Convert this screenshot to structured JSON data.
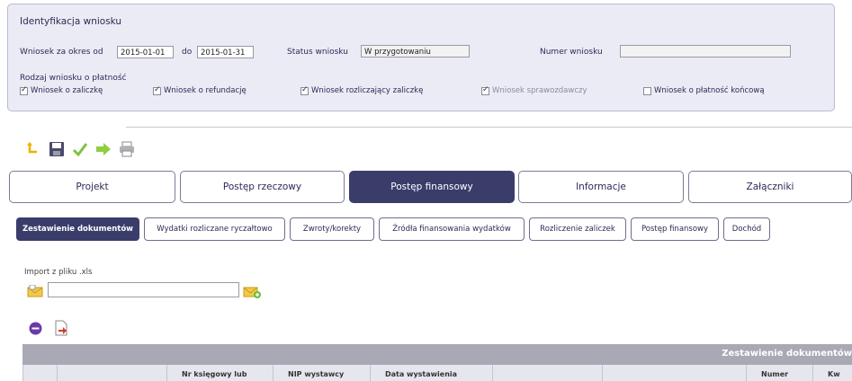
{
  "panel": {
    "title": "Identyfikacja wniosku",
    "period_from_label": "Wniosek za okres od",
    "period_from_value": "2015-01-01",
    "period_to_label": "do",
    "period_to_value": "2015-01-31",
    "status_label": "Status wniosku",
    "status_value": "W przygotowaniu",
    "number_label": "Numer wniosku",
    "number_value": "",
    "type_label": "Rodzaj wniosku o płatność",
    "checkboxes": [
      {
        "label": "Wniosek o zaliczkę",
        "checked": true
      },
      {
        "label": "Wniosek o refundację",
        "checked": true
      },
      {
        "label": "Wniosek rozliczający zaliczkę",
        "checked": true
      },
      {
        "label": "Wniosek sprawozdawczy",
        "checked": true
      },
      {
        "label": "Wniosek o płatność końcową",
        "checked": false
      }
    ]
  },
  "toolbar": {
    "icons": [
      "undo-icon",
      "save-icon",
      "validate-icon",
      "send-icon",
      "print-icon"
    ]
  },
  "tabs": [
    {
      "label": "Projekt",
      "active": false
    },
    {
      "label": "Postęp rzeczowy",
      "active": false
    },
    {
      "label": "Postęp finansowy",
      "active": true
    },
    {
      "label": "Informacje",
      "active": false
    },
    {
      "label": "Załączniki",
      "active": false
    }
  ],
  "subtabs": [
    {
      "label": "Zestawienie dokumentów",
      "active": true
    },
    {
      "label": "Wydatki rozliczane ryczałtowo",
      "active": false
    },
    {
      "label": "Zwroty/korekty",
      "active": false
    },
    {
      "label": "Źródła finansowania wydatków",
      "active": false
    },
    {
      "label": "Rozliczenie zaliczek",
      "active": false
    },
    {
      "label": "Postęp finansowy",
      "active": false
    },
    {
      "label": "Dochód",
      "active": false
    }
  ],
  "import": {
    "label": "Import z pliku .xls"
  },
  "grid": {
    "title": "Zestawienie dokumentów",
    "columns": [
      "",
      "",
      "Nr księgowy lub",
      "NIP wystawcy",
      "Data wystawienia",
      "",
      "",
      "Numer",
      "Kw"
    ]
  },
  "colors": {
    "accent": "#3a3d6a",
    "panel_bg": "#ebebf6",
    "grid_header": "#a9a9b6"
  }
}
